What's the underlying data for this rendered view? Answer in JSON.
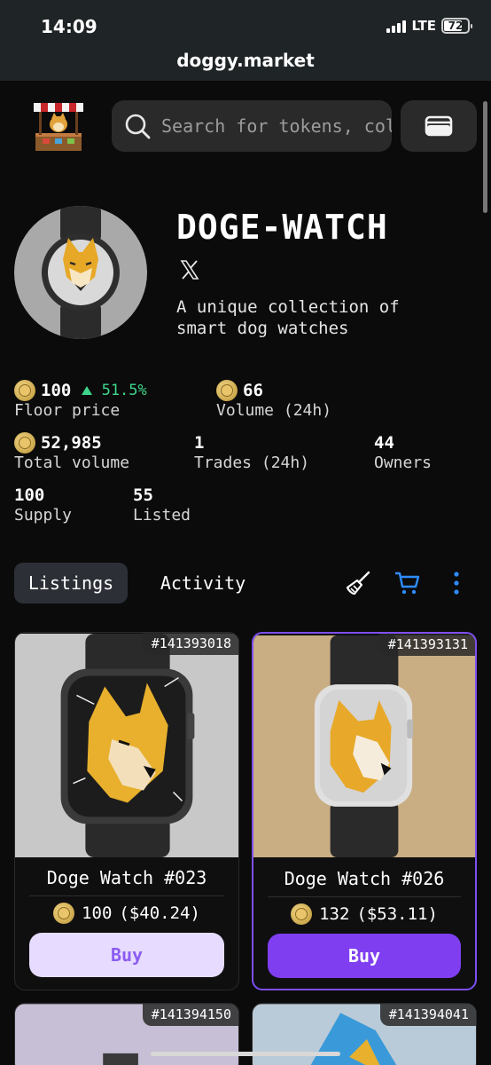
{
  "status": {
    "time": "14:09",
    "network": "LTE",
    "battery": "72"
  },
  "browser": {
    "url": "doggy.market"
  },
  "header": {
    "search_placeholder": "Search for tokens, collections"
  },
  "collection": {
    "title": "DOGE-WATCH",
    "description": "A unique collection of smart dog watches"
  },
  "stats": {
    "floor_price": {
      "value": "100",
      "change": "51.5%",
      "label": "Floor price"
    },
    "volume_24h": {
      "value": "66",
      "label": "Volume (24h)"
    },
    "total_volume": {
      "value": "52,985",
      "label": "Total volume"
    },
    "trades_24h": {
      "value": "1",
      "label": "Trades (24h)"
    },
    "owners": {
      "value": "44",
      "label": "Owners"
    },
    "supply": {
      "value": "100",
      "label": "Supply"
    },
    "listed": {
      "value": "55",
      "label": "Listed"
    }
  },
  "tabs": {
    "listings": "Listings",
    "activity": "Activity"
  },
  "listings": [
    {
      "id": "#141393018",
      "name": "Doge Watch #023",
      "price": "100",
      "usd": "($40.24)",
      "buy": "Buy"
    },
    {
      "id": "#141393131",
      "name": "Doge Watch #026",
      "price": "132",
      "usd": "($53.11)",
      "buy": "Buy"
    },
    {
      "id": "#141394150"
    },
    {
      "id": "#141394041"
    }
  ],
  "colors": {
    "accent": "#7f3ff1",
    "positive": "#3dd68c",
    "link_blue": "#2f8cff"
  }
}
